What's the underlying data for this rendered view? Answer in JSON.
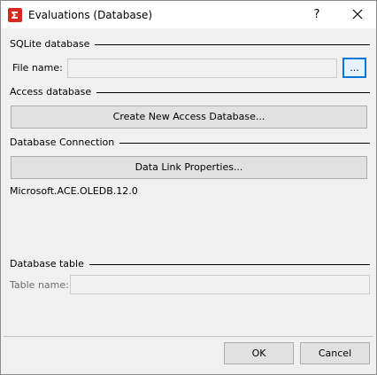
{
  "window": {
    "title": "Evaluations (Database)",
    "help_label": "?",
    "brand_color": "#d52b1e"
  },
  "sqlite": {
    "group_label": "SQLite database",
    "file_label": "File name:",
    "file_value": "",
    "browse_label": "..."
  },
  "access": {
    "group_label": "Access database",
    "create_label": "Create New Access Database..."
  },
  "connection": {
    "group_label": "Database Connection",
    "properties_label": "Data Link Properties...",
    "provider": "Microsoft.ACE.OLEDB.12.0"
  },
  "table": {
    "group_label": "Database table",
    "name_label": "Table name:",
    "name_value": ""
  },
  "footer": {
    "ok_label": "OK",
    "cancel_label": "Cancel"
  }
}
